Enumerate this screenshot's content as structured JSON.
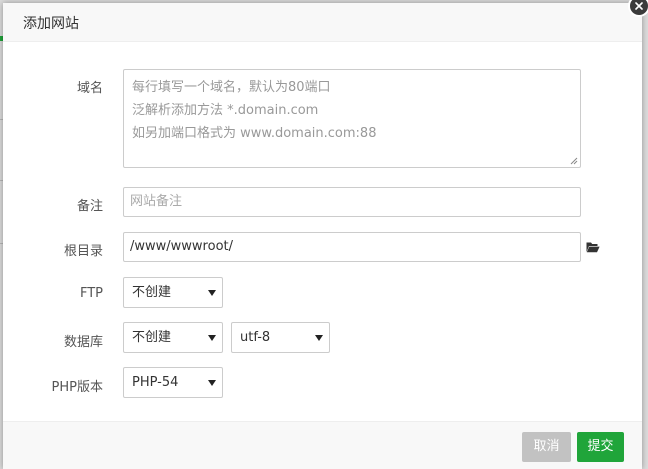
{
  "dialog": {
    "title": "添加网站"
  },
  "form": {
    "domain": {
      "label": "域名",
      "placeholder_lines": [
        "每行填写一个域名，默认为80端口",
        "泛解析添加方法 *.domain.com",
        "如另加端口格式为 www.domain.com:88"
      ]
    },
    "remark": {
      "label": "备注",
      "placeholder": "网站备注"
    },
    "root_dir": {
      "label": "根目录",
      "value": "/www/wwwroot/"
    },
    "ftp": {
      "label": "FTP",
      "selected": "不创建"
    },
    "database": {
      "label": "数据库",
      "selected": "不创建",
      "charset_selected": "utf-8"
    },
    "php_version": {
      "label": "PHP版本",
      "selected": "PHP-54"
    }
  },
  "footer": {
    "cancel_label": "取消",
    "submit_label": "提交"
  },
  "colors": {
    "primary": "#20a53a",
    "cancel": "#c2c2c2",
    "close": "#3b3b3b"
  },
  "icons": {
    "close": "close-icon",
    "folder": "folder-open-icon",
    "dropdown": "caret-down-icon"
  }
}
